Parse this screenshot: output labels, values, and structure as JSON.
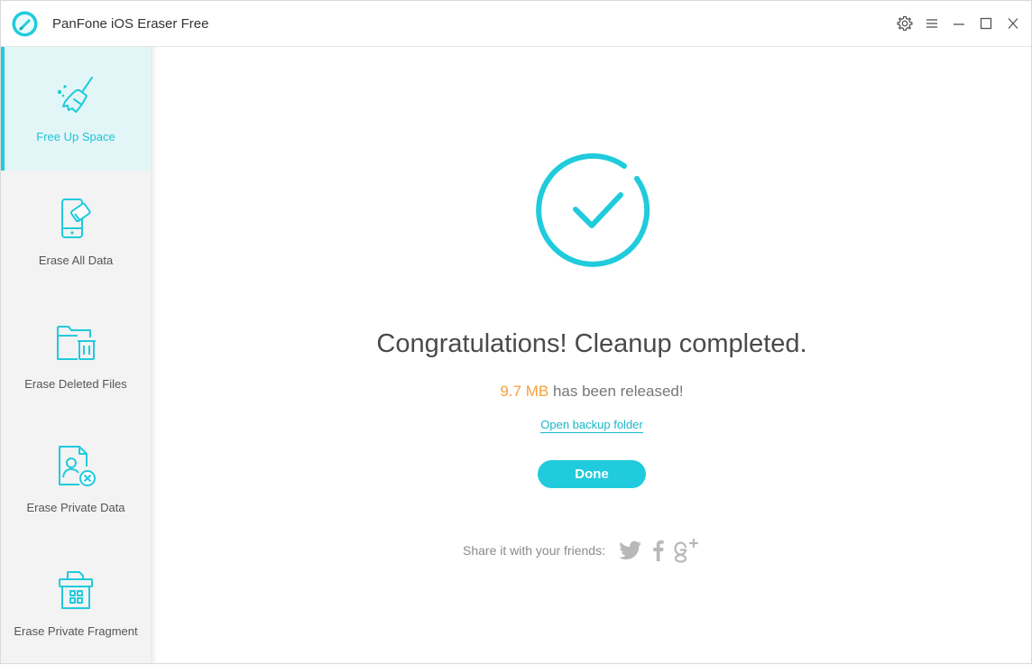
{
  "app": {
    "title": "PanFone iOS Eraser Free"
  },
  "window_controls": [
    "settings-icon",
    "menu-icon",
    "minimize-icon",
    "maximize-icon",
    "close-icon"
  ],
  "sidebar": {
    "items": [
      {
        "label": "Free Up Space",
        "icon": "broom-icon",
        "active": true
      },
      {
        "label": "Erase All Data",
        "icon": "phone-eraser-icon",
        "active": false
      },
      {
        "label": "Erase Deleted Files",
        "icon": "folder-trash-icon",
        "active": false
      },
      {
        "label": "Erase Private Data",
        "icon": "contact-file-delete-icon",
        "active": false
      },
      {
        "label": "Erase Private Fragment",
        "icon": "fragment-bin-icon",
        "active": false
      }
    ]
  },
  "main": {
    "status_icon": "checkmark-circle-icon",
    "heading": "Congratulations! Cleanup completed.",
    "released_size": "9.7 MB",
    "released_text": " has been released!",
    "open_backup_label": "Open backup folder",
    "done_label": "Done",
    "share_label": "Share it with your friends:",
    "share_icons": [
      "twitter-icon",
      "facebook-icon",
      "google-plus-icon"
    ]
  },
  "colors": {
    "accent": "#1fcbdc",
    "highlight": "#f7a13a",
    "active_bg": "#e2f6f8",
    "sidebar_bg": "#f3f3f3"
  }
}
